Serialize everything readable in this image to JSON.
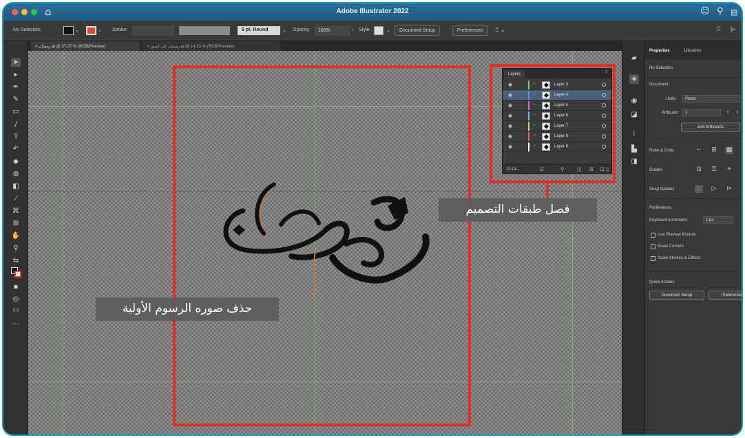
{
  "window": {
    "title": "Adobe Illustrator 2022"
  },
  "control_bar": {
    "selection": "No Selection",
    "stroke_label": "Stroke:",
    "brush": "5 pt. Round",
    "opacity_label": "Opacity:",
    "opacity_value": "100%",
    "style_label": "Style:",
    "document_setup": "Document Setup",
    "preferences": "Preferences"
  },
  "tabs": [
    {
      "label": "رمضان.ai @ 37.07 % (RGB/Preview)"
    },
    {
      "label": "رمضان كل الصور.ai @ 14.23 % (RGB/Preview)"
    }
  ],
  "layers_panel": {
    "title": "Layers",
    "layers": [
      {
        "name": "Layer 3",
        "color": "#6fd06f",
        "selected": false
      },
      {
        "name": "Layer 4",
        "color": "#5b8cff",
        "selected": true
      },
      {
        "name": "Layer 5",
        "color": "#e860e0",
        "selected": false
      },
      {
        "name": "Layer 6",
        "color": "#5bc8e8",
        "selected": false
      },
      {
        "name": "Layer 7",
        "color": "#e8d24a",
        "selected": false
      },
      {
        "name": "Layer 8",
        "color": "#e86060",
        "selected": false
      },
      {
        "name": "Layer 9",
        "color": "#ffffff",
        "selected": false
      }
    ],
    "count": "10 La..."
  },
  "annotations": {
    "layers_callout": "فصل طبقات التصميم",
    "delete_callout": "حذف صوره الرسوم الأولية",
    "box_color": "#e62c27"
  },
  "properties_panel": {
    "tab_properties": "Properties",
    "tab_libraries": "Libraries",
    "no_selection": "No Selection",
    "document_heading": "Document",
    "units_label": "Units:",
    "units_value": "Pixels",
    "artboard_label": "Artboard:",
    "artboard_value": "1",
    "edit_artboards": "Edit Artboards",
    "ruler_grids": "Ruler & Grids",
    "guides": "Guides",
    "snap_options": "Snap Options",
    "preferences_heading": "Preferences",
    "keyboard_increment_label": "Keyboard Increment:",
    "keyboard_increment_value": "1 px",
    "use_preview_bounds": "Use Preview Bounds",
    "scale_corners": "Scale Corners",
    "scale_strokes": "Scale Strokes & Effects",
    "quick_actions": "Quick Actions",
    "document_setup_button": "Document Setup",
    "preferences_button": "Preferences"
  },
  "colors": {
    "titlebar": "#1e5a82",
    "frame_border": "#1a9ec4"
  }
}
